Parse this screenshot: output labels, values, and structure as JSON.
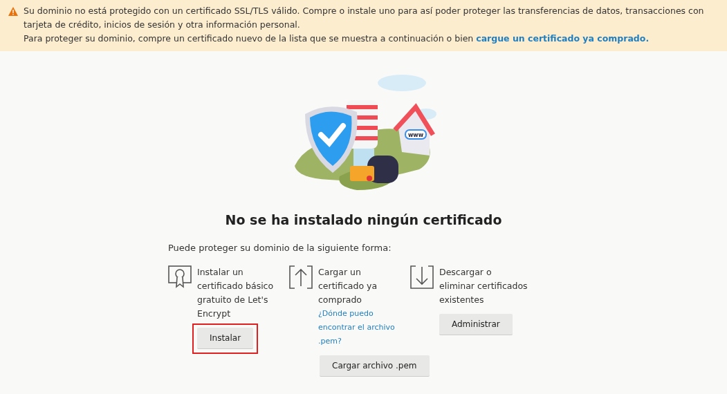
{
  "alert": {
    "lines": [
      "Su dominio no está protegido con un certificado SSL/TLS válido. Compre o instale uno para así poder proteger las transferencias de datos, transacciones con tarjeta de crédito, inicios de sesión y otra información personal."
    ],
    "line2": {
      "text": "Para proteger su dominio, compre un certificado nuevo de la lista que se muestra a continuación o bien ",
      "link": "cargue un certificado ya comprado."
    }
  },
  "illustration": {
    "sign": "www"
  },
  "heading": "No se ha instalado ningún certificado",
  "intro": "Puede proteger su dominio de la siguiente forma:",
  "options": [
    {
      "kind": "install",
      "text": "Instalar un certificado básico gratuito de Let's Encrypt",
      "button": "Instalar",
      "highlighted": true
    },
    {
      "kind": "upload",
      "text": "Cargar un certificado ya comprado",
      "link": "¿Dónde puedo encontrar el archivo .pem?",
      "button": "Cargar archivo .pem",
      "highlighted": false
    },
    {
      "kind": "download",
      "text": "Descargar o eliminar certificados existentes",
      "button": "Administrar",
      "highlighted": false
    }
  ]
}
